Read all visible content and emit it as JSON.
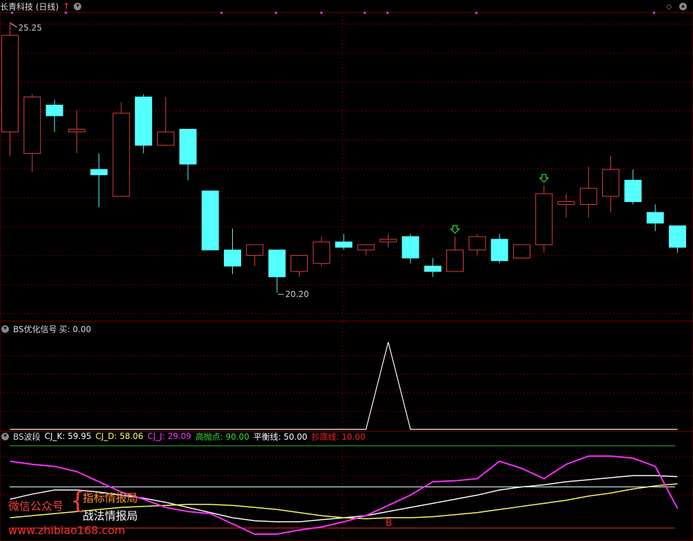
{
  "main_panel": {
    "title": "长青科技 (日线)",
    "high_label": "25.25",
    "low_label": "20.20",
    "grid_color": "#7a0000",
    "up_color": "#e04040",
    "down_color": "#54ffff"
  },
  "signal_panel": {
    "title": "BS优化信号",
    "buy_label": "买: 0.00"
  },
  "wave_panel": {
    "title": "BS波段",
    "cj_k": "CJ_K: 59.95",
    "cj_d": "CJ_D: 58.06",
    "cj_j": "CJ_J: 29.09",
    "high_throw": "高抛点: 90.00",
    "balance": "平衡线: 50.00",
    "bottom_buy": "抄底线: 10.00",
    "b_marker": "B",
    "colors": {
      "k": "#ffffff",
      "d": "#ffff60",
      "j": "#ff30ff",
      "high": "#30c030",
      "balance": "#ffffff",
      "bottom": "#ff2020"
    }
  },
  "watermark": {
    "wechat_label": "微信公众号",
    "line1": "指标情报局",
    "line2": "战法情报局",
    "url": "www.zhibiao168.com"
  },
  "chart_data": [
    {
      "type": "candlestick",
      "title": "长青科技 (日线)",
      "ylim": [
        19.7,
        25.4
      ],
      "candles": [
        {
          "o": 23.2,
          "h": 25.25,
          "l": 22.75,
          "c": 25.0
        },
        {
          "o": 22.8,
          "h": 23.9,
          "l": 22.45,
          "c": 23.85
        },
        {
          "o": 23.7,
          "h": 23.8,
          "l": 23.2,
          "c": 23.5
        },
        {
          "o": 23.2,
          "h": 23.6,
          "l": 22.8,
          "c": 23.25
        },
        {
          "o": 22.5,
          "h": 22.8,
          "l": 21.8,
          "c": 22.4
        },
        {
          "o": 22.0,
          "h": 23.75,
          "l": 22.0,
          "c": 23.55
        },
        {
          "o": 23.85,
          "h": 23.9,
          "l": 22.8,
          "c": 22.95
        },
        {
          "o": 22.95,
          "h": 23.85,
          "l": 22.95,
          "c": 23.2
        },
        {
          "o": 23.25,
          "h": 23.25,
          "l": 22.3,
          "c": 22.6
        },
        {
          "o": 22.1,
          "h": 22.1,
          "l": 21.0,
          "c": 21.0
        },
        {
          "o": 21.0,
          "h": 21.4,
          "l": 20.55,
          "c": 20.7
        },
        {
          "o": 20.9,
          "h": 21.1,
          "l": 20.7,
          "c": 21.1
        },
        {
          "o": 21.0,
          "h": 21.0,
          "l": 20.2,
          "c": 20.5
        },
        {
          "o": 20.6,
          "h": 20.85,
          "l": 20.5,
          "c": 20.9
        },
        {
          "o": 20.75,
          "h": 21.25,
          "l": 20.7,
          "c": 21.15
        },
        {
          "o": 21.15,
          "h": 21.3,
          "l": 21.0,
          "c": 21.05
        },
        {
          "o": 21.0,
          "h": 21.1,
          "l": 20.9,
          "c": 21.1
        },
        {
          "o": 21.15,
          "h": 21.3,
          "l": 21.05,
          "c": 21.2
        },
        {
          "o": 21.25,
          "h": 21.3,
          "l": 20.75,
          "c": 20.85
        },
        {
          "o": 20.7,
          "h": 20.85,
          "l": 20.5,
          "c": 20.6
        },
        {
          "o": 20.6,
          "h": 21.25,
          "l": 20.6,
          "c": 21.0
        },
        {
          "o": 21.0,
          "h": 21.3,
          "l": 20.9,
          "c": 21.25
        },
        {
          "o": 21.2,
          "h": 21.3,
          "l": 20.75,
          "c": 20.8
        },
        {
          "o": 20.85,
          "h": 21.1,
          "l": 20.85,
          "c": 21.1
        },
        {
          "o": 21.1,
          "h": 22.2,
          "l": 20.95,
          "c": 22.05
        },
        {
          "o": 21.85,
          "h": 22.05,
          "l": 21.6,
          "c": 21.9
        },
        {
          "o": 21.85,
          "h": 22.55,
          "l": 21.6,
          "c": 22.15
        },
        {
          "o": 22.0,
          "h": 22.75,
          "l": 21.7,
          "c": 22.5
        },
        {
          "o": 22.3,
          "h": 22.5,
          "l": 21.85,
          "c": 21.9
        },
        {
          "o": 21.7,
          "h": 21.85,
          "l": 21.35,
          "c": 21.5
        },
        {
          "o": 21.45,
          "h": 21.45,
          "l": 20.95,
          "c": 21.05
        }
      ],
      "signal_arrows": [
        24,
        20
      ]
    },
    {
      "type": "line",
      "title": "BS优化信号",
      "ylim": [
        0,
        1.05
      ],
      "series": [
        {
          "name": "买",
          "values": [
            0,
            0,
            0,
            0,
            0,
            0,
            0,
            0,
            0,
            0,
            0,
            0,
            0,
            0,
            0,
            0,
            0,
            1,
            0,
            0,
            0,
            0,
            0,
            0,
            0,
            0,
            0,
            0,
            0,
            0,
            0
          ]
        }
      ]
    },
    {
      "type": "line",
      "title": "BS波段",
      "ylim": [
        0,
        100
      ],
      "reference_lines": [
        90,
        50,
        10
      ],
      "series": [
        {
          "name": "CJ_K",
          "values": [
            38,
            43,
            47,
            47,
            45,
            42,
            39,
            35,
            30,
            25,
            20,
            17,
            16,
            16,
            18,
            20,
            22,
            26,
            30,
            34,
            38,
            42,
            47,
            50,
            52,
            55,
            57,
            59,
            61,
            61,
            60
          ]
        },
        {
          "name": "CJ_D",
          "values": [
            20,
            22,
            24,
            26,
            28,
            30,
            31,
            32,
            33,
            33,
            32,
            30,
            28,
            25,
            22,
            20,
            19,
            20,
            20,
            21,
            23,
            25,
            28,
            31,
            34,
            37,
            41,
            44,
            48,
            51,
            53
          ]
        },
        {
          "name": "CJ_J",
          "values": [
            75,
            72,
            70,
            65,
            55,
            45,
            38,
            30,
            26,
            24,
            14,
            4,
            4,
            8,
            11,
            16,
            22,
            32,
            42,
            55,
            56,
            58,
            75,
            68,
            58,
            72,
            80,
            80,
            78,
            70,
            29
          ]
        }
      ]
    }
  ]
}
